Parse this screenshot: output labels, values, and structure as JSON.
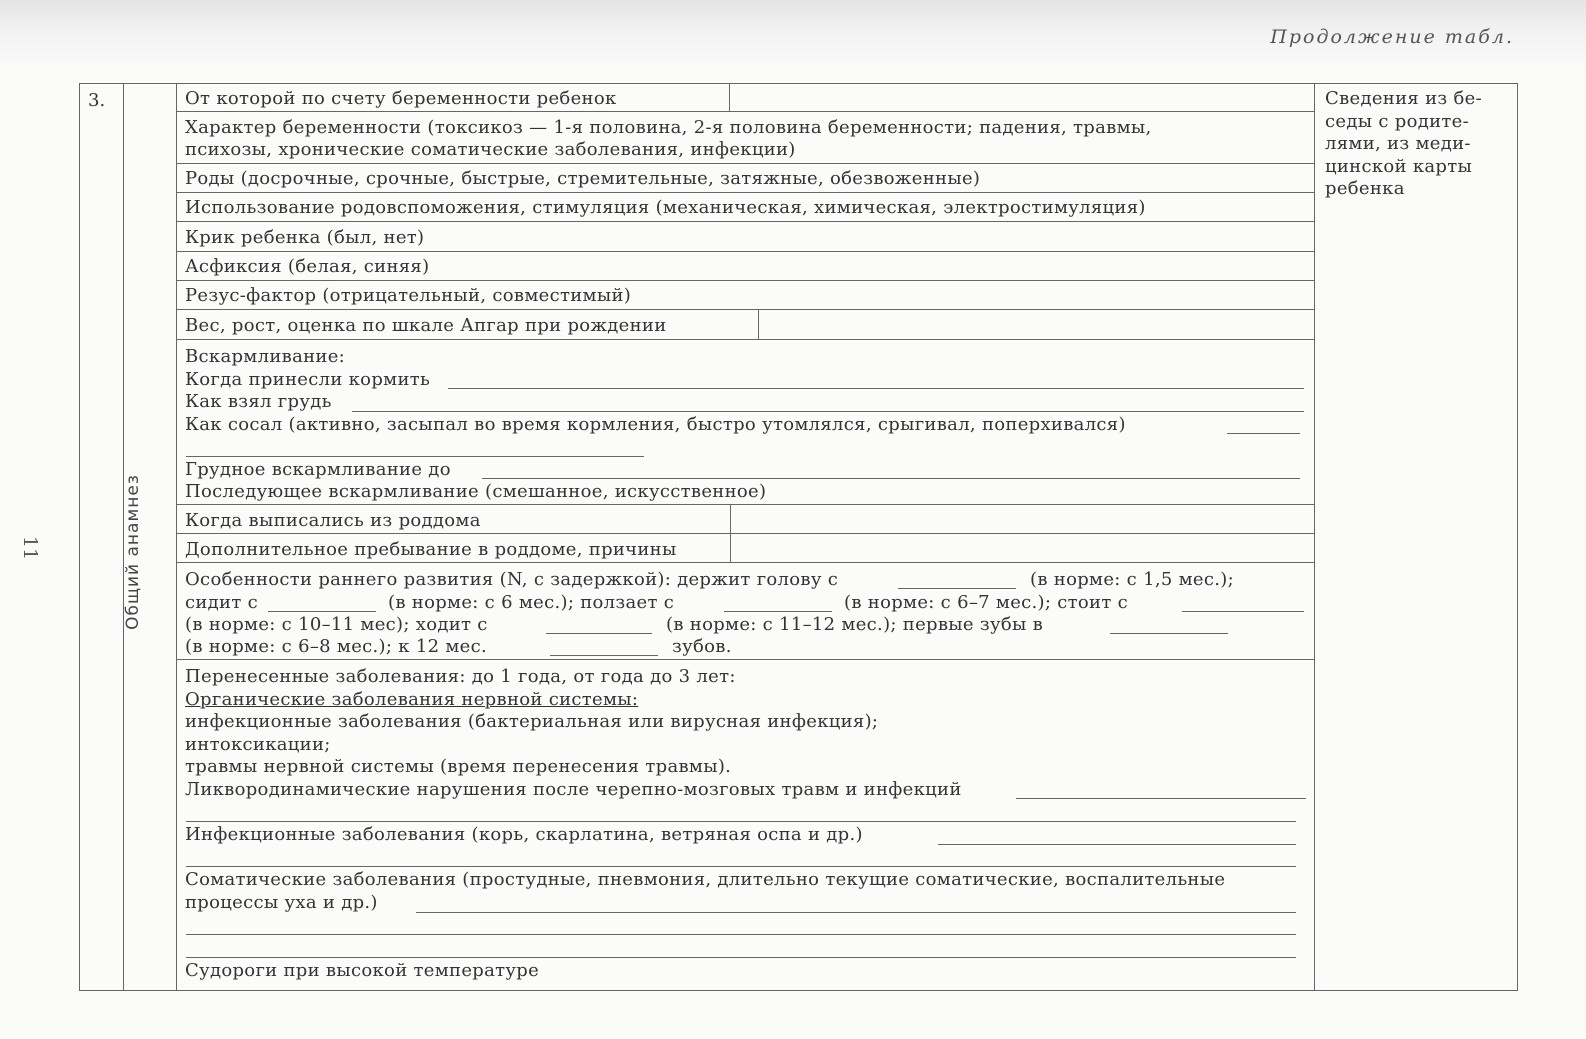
{
  "header": {
    "continuation": "Продолжение табл.",
    "page_number": "11"
  },
  "table": {
    "number": "3.",
    "section": "Общий анамнез",
    "note": [
      "Сведения из бе-",
      "седы с родите-",
      "лями, из меди-",
      "цинской карты",
      "ребенка"
    ],
    "rows": {
      "pregnancy_order": "От которой по счету беременности ребенок",
      "pregnancy_character": [
        "Характер беременности (токсикоз — 1-я половина, 2-я половина  беременности; падения, травмы,",
        "психозы, хронические соматические заболевания, инфекции)"
      ],
      "birth": "Роды (досрочные, срочные, быстрые, стремительные, затяжные, обезвоженные)",
      "assistance": "Использование родовспоможения, стимуляция (механическая, химическая, электростимуляция)",
      "cry": "Крик  ребенка  (был, нет)",
      "asphyxia": "Асфиксия (белая, синяя)",
      "rhesus": "Резус-фактор (отрицательный, совместимый)",
      "weight": "Вес, рост, оценка по шкале Апгар  при рождении",
      "feeding": {
        "title": "Вскармливание:",
        "when_fed": "Когда принесли кормить",
        "breast": "Как взял грудь",
        "sucked": "Как сосал (активно, засыпал во время кормления, быстро утомлялся, срыгивал, поперхивался)",
        "breastfeeding": "Грудное вскармливание до",
        "subsequent": "Последующее вскармливание (смешанное, искусственное)"
      },
      "discharge": "Когда выписались из роддома",
      "extra_stay": "Дополнительное пребывание в роддоме, причины",
      "development": [
        "Особенности раннего развития (N, с задержкой): держит голову с",
        "(в норме: с 1,5 мес.);",
        "сидит с",
        "(в норме: с 6 мес.); ползает с",
        "(в норме: с 6–7 мес.); стоит с",
        "(в норме: с 10–11 мес); ходит с",
        "(в норме: с 11–12 мес.); первые зубы в",
        "(в норме: с 6–8 мес.); к 12 мес.",
        "зубов."
      ],
      "diseases": {
        "title": "Перенесенные заболевания: до 1 года, от года до 3 лет:",
        "organic": "Органические заболевания нервной системы:",
        "infectious_nervous": "инфекционные заболевания (бактериальная или вирусная инфекция);",
        "intox": "интоксикации;",
        "trauma": "травмы нервной системы (время перенесения травмы).",
        "liquor": "Ликвородинамические нарушения после черепно-мозговых травм и инфекций",
        "infectious": "Инфекционные заболевания (корь, скарлатина, ветряная оспа и др.)",
        "somatic": [
          "Соматические заболевания (простудные, пневмония, длительно текущие соматические, воспалительные",
          "процессы уха и др.)"
        ],
        "seizures": "Судороги при высокой температуре"
      }
    }
  }
}
